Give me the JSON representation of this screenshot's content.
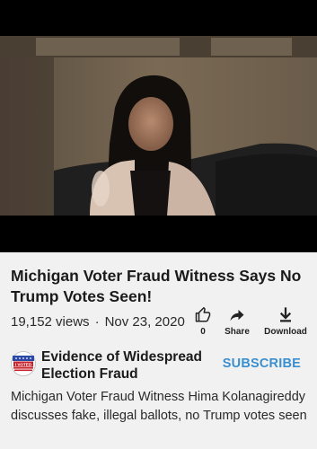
{
  "video": {
    "title": "Michigan Voter Fraud Witness Says No Trump Votes Seen!"
  },
  "stats": {
    "views": "19,152 views",
    "separator": "·",
    "date": "Nov 23, 2020"
  },
  "actions": {
    "like_count": "0",
    "share_label": "Share",
    "download_label": "Download"
  },
  "channel": {
    "name": "Evidence of Widespread Election Fraud",
    "logo_text": "I VOTED",
    "subscribe_label": "SUBSCRIBE"
  },
  "description": "Michigan Voter Fraud Witness Hima Kolanagireddy discusses fake, illegal ballots, no Trump votes seen",
  "colors": {
    "accent": "#3a8fd0",
    "background": "#f1f1f1"
  },
  "icons": [
    "thumbs-up-icon",
    "share-icon",
    "download-icon"
  ]
}
